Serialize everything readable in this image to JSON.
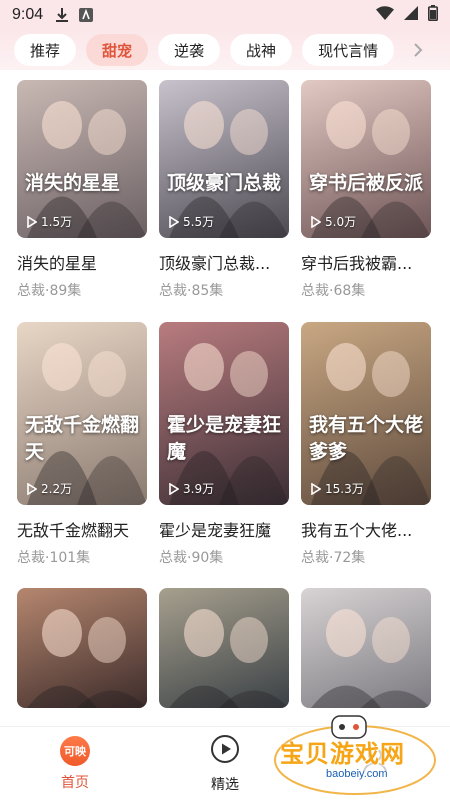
{
  "status": {
    "time": "9:04"
  },
  "tabs": [
    {
      "label": "推荐"
    },
    {
      "label": "甜宠"
    },
    {
      "label": "逆袭"
    },
    {
      "label": "战神"
    },
    {
      "label": "现代言情"
    }
  ],
  "cards": [
    {
      "title": "消失的星星",
      "meta": "总裁·89集",
      "plays": "1.5万",
      "overlay": "消失的星星",
      "colors": [
        "#6b5f63",
        "#c9b9b4"
      ]
    },
    {
      "title": "顶级豪门总裁...",
      "meta": "总裁·85集",
      "plays": "5.5万",
      "overlay": "顶级豪门总裁",
      "colors": [
        "#4d4a52",
        "#c8c2cc"
      ]
    },
    {
      "title": "穿书后我被霸...",
      "meta": "总裁·68集",
      "plays": "5.0万",
      "overlay": "穿书后被反派",
      "colors": [
        "#6e5556",
        "#e3c9c3"
      ]
    },
    {
      "title": "无敌千金燃翻天",
      "meta": "总裁·101集",
      "plays": "2.2万",
      "overlay": "无敌千金燃翻天",
      "colors": [
        "#8a7a70",
        "#e8d6c6"
      ]
    },
    {
      "title": "霍少是宠妻狂魔",
      "meta": "总裁·90集",
      "plays": "3.9万",
      "overlay": "霍少是宠妻狂魔",
      "colors": [
        "#3b2f35",
        "#b97c7f"
      ]
    },
    {
      "title": "我有五个大佬...",
      "meta": "总裁·72集",
      "plays": "15.3万",
      "overlay": "我有五个大佬爹爹",
      "colors": [
        "#5e4a3d",
        "#c9a883"
      ]
    },
    {
      "title": "",
      "meta": "",
      "plays": "",
      "overlay": "",
      "colors": [
        "#3c2b2a",
        "#b6876f"
      ]
    },
    {
      "title": "",
      "meta": "",
      "plays": "",
      "overlay": "",
      "colors": [
        "#3a4045",
        "#a7a08e"
      ]
    },
    {
      "title": "",
      "meta": "",
      "plays": "",
      "overlay": "",
      "colors": [
        "#7b7a80",
        "#d8d3d4"
      ]
    }
  ],
  "nav": [
    {
      "label": "首页",
      "badge": "可映"
    },
    {
      "label": "精选"
    },
    {
      "label": ""
    }
  ],
  "watermark": {
    "text": "宝贝游戏网",
    "sub": "baobeiy.com"
  },
  "accent": "#e0553a"
}
